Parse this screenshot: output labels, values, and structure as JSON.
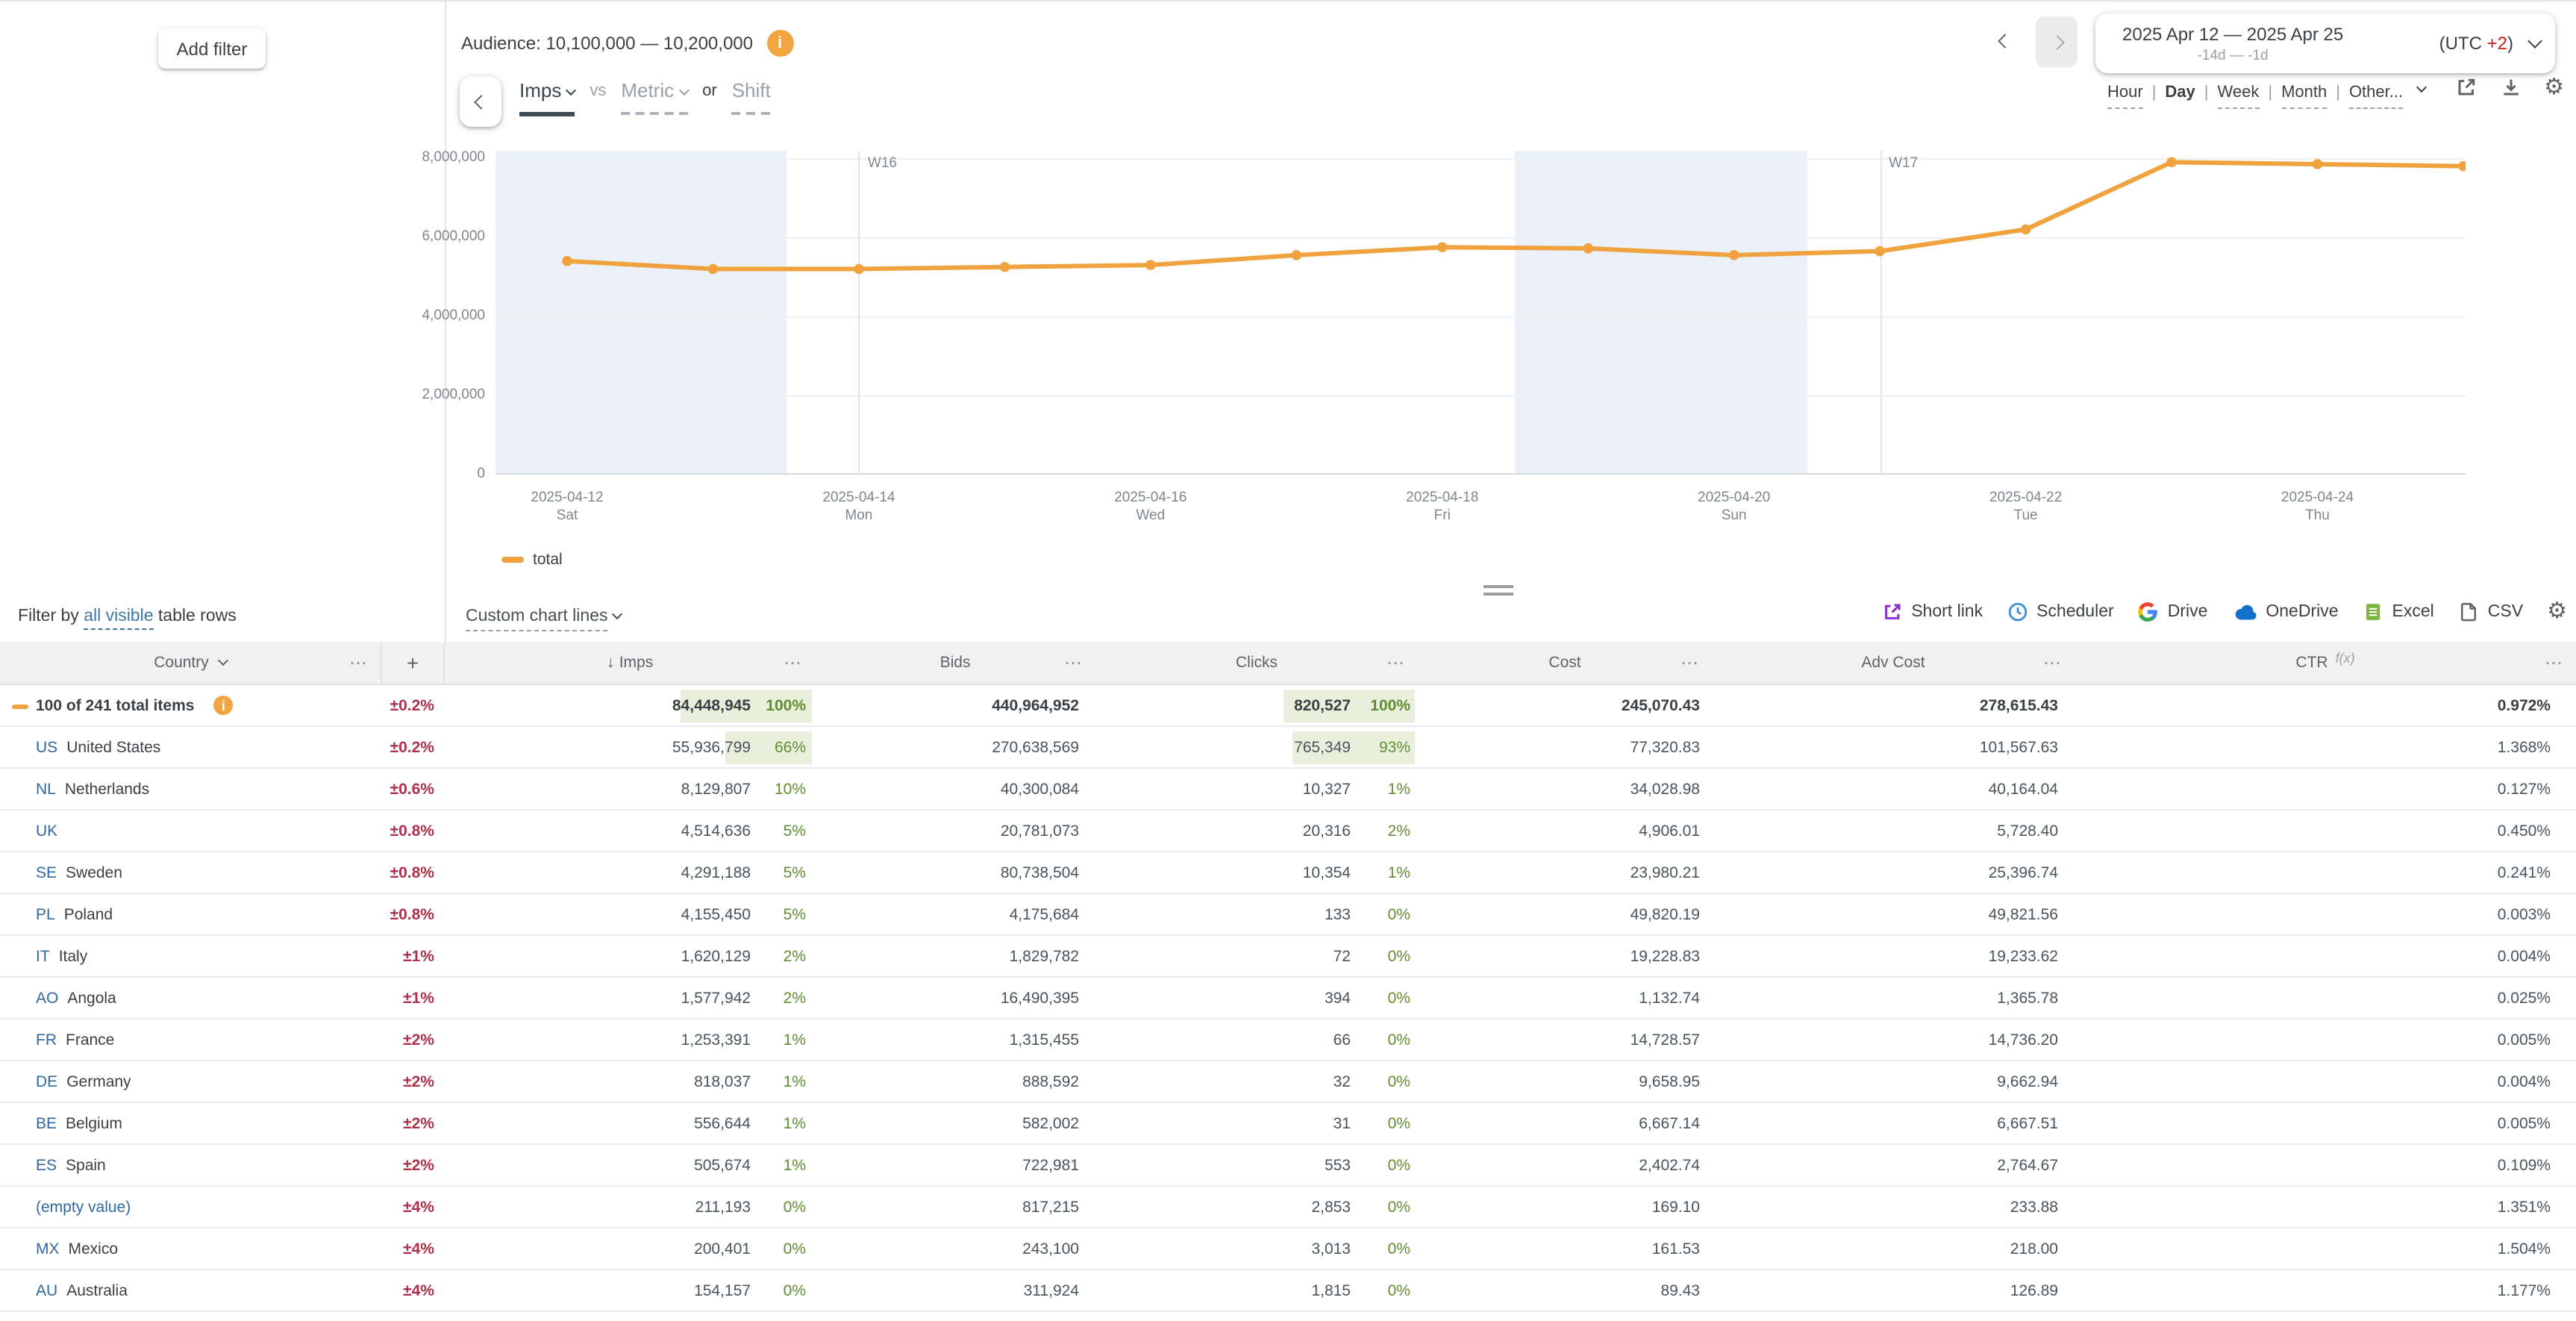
{
  "colors": {
    "accent_orange": "#F0A23E",
    "weekend_band": "#EBF1F8",
    "positive_green": "#5E8E2E",
    "green_bar_bg": "#E9EFDC",
    "uncertainty_red": "#AE3049",
    "country_code_blue": "#33689E",
    "link_blue": "#4176A4",
    "shortlink_purple": "#8630CF",
    "scheduler_blue": "#3E8DDD",
    "excel_green": "#7FB441",
    "utc_red": "#C5221F"
  },
  "icons": {
    "info_glyph": "i",
    "gear_glyph": "⚙",
    "dots_glyph": "⋯",
    "sort_desc_glyph": "↓"
  },
  "topbar": {
    "add_filter_label": "Add filter",
    "audience_label": "Audience: 10,100,000 — 10,200,000",
    "date_range": {
      "title": "2025 Apr 12 — 2025 Apr 25",
      "subtitle": "-14d — -1d",
      "utc_prefix": "(UTC",
      "utc_offset": "+2",
      "utc_suffix": ")"
    }
  },
  "series_picker": {
    "primary": "Imps",
    "vs_label": "vs",
    "metric_label": "Metric",
    "or_label": "or",
    "shift_label": "Shift"
  },
  "granularity": {
    "options": [
      "Hour",
      "Day",
      "Week",
      "Month",
      "Other..."
    ],
    "selected": "Day",
    "separator": "|"
  },
  "chart_data": {
    "type": "line",
    "x": [
      "2025-04-12",
      "2025-04-13",
      "2025-04-14",
      "2025-04-15",
      "2025-04-16",
      "2025-04-17",
      "2025-04-18",
      "2025-04-19",
      "2025-04-20",
      "2025-04-21",
      "2025-04-22",
      "2025-04-23",
      "2025-04-24",
      "2025-04-25"
    ],
    "series": [
      {
        "name": "total",
        "color": "#F0A23E",
        "values": [
          5400000,
          5200000,
          5200000,
          5250000,
          5300000,
          5550000,
          5750000,
          5720000,
          5550000,
          5650000,
          6200000,
          7900000,
          7850000,
          7800000
        ]
      }
    ],
    "ylim": [
      0,
      8190000
    ],
    "grid": true,
    "legend_position": "bottom-left",
    "y_ticks": [
      {
        "value": 0,
        "label": "0"
      },
      {
        "value": 2000000,
        "label": "2,000,000"
      },
      {
        "value": 4000000,
        "label": "4,000,000"
      },
      {
        "value": 6000000,
        "label": "6,000,000"
      },
      {
        "value": 8000000,
        "label": "8,000,000"
      }
    ],
    "x_ticks": [
      {
        "index": 0,
        "date": "2025-04-12",
        "weekday": "Sat"
      },
      {
        "index": 2,
        "date": "2025-04-14",
        "weekday": "Mon"
      },
      {
        "index": 4,
        "date": "2025-04-16",
        "weekday": "Wed"
      },
      {
        "index": 6,
        "date": "2025-04-18",
        "weekday": "Fri"
      },
      {
        "index": 8,
        "date": "2025-04-20",
        "weekday": "Sun"
      },
      {
        "index": 10,
        "date": "2025-04-22",
        "weekday": "Tue"
      },
      {
        "index": 12,
        "date": "2025-04-24",
        "weekday": "Thu"
      }
    ],
    "weekend_bands": [
      {
        "from_index": -0.5,
        "to_index": 1.5
      },
      {
        "from_index": 6.5,
        "to_index": 8.5
      }
    ],
    "week_markers": [
      {
        "index": 2,
        "label": "W16"
      },
      {
        "index": 9,
        "label": "W17"
      }
    ],
    "legend": [
      {
        "label": "total",
        "color": "#F0A23E"
      }
    ]
  },
  "filter_row": {
    "prefix": "Filter by ",
    "link_label": "all visible",
    "suffix": " table rows",
    "custom_chart_lines_label": "Custom chart lines"
  },
  "toolbar": {
    "items": [
      {
        "icon": "short-link-icon",
        "label": "Short link"
      },
      {
        "icon": "scheduler-clock-icon",
        "label": "Scheduler"
      },
      {
        "icon": "google-drive-icon",
        "label": "Drive"
      },
      {
        "icon": "onedrive-cloud-icon",
        "label": "OneDrive"
      },
      {
        "icon": "excel-icon",
        "label": "Excel"
      },
      {
        "icon": "csv-file-icon",
        "label": "CSV"
      }
    ]
  },
  "table": {
    "headers": [
      {
        "label": "Country"
      },
      {
        "label": "+"
      },
      {
        "label": "Imps",
        "sort": "desc"
      },
      {
        "label": "Bids"
      },
      {
        "label": "Clicks"
      },
      {
        "label": "Cost"
      },
      {
        "label": "Adv Cost"
      },
      {
        "label": "CTR",
        "fx": "f(x)"
      }
    ],
    "rows": [
      {
        "icon": "total-dash",
        "info": true,
        "bold": true,
        "code": "",
        "name": "100 of 241 total items",
        "name_blue": false,
        "pm": "±0.2%",
        "imps": "84,448,945",
        "imps_pct": "100%",
        "imps_bar": 100,
        "bids": "440,964,952",
        "clicks": "820,527",
        "clicks_pct": "100%",
        "clicks_bar": 100,
        "cost": "245,070.43",
        "adv_cost": "278,615.43",
        "ctr": "0.972%"
      },
      {
        "code": "US",
        "name": "United States",
        "name_blue": false,
        "pm": "±0.2%",
        "imps": "55,936,799",
        "imps_pct": "66%",
        "imps_bar": 66,
        "bids": "270,638,569",
        "clicks": "765,349",
        "clicks_pct": "93%",
        "clicks_bar": 93,
        "cost": "77,320.83",
        "adv_cost": "101,567.63",
        "ctr": "1.368%"
      },
      {
        "code": "NL",
        "name": "Netherlands",
        "name_blue": false,
        "pm": "±0.6%",
        "imps": "8,129,807",
        "imps_pct": "10%",
        "imps_bar": 0,
        "bids": "40,300,084",
        "clicks": "10,327",
        "clicks_pct": "1%",
        "clicks_bar": 0,
        "cost": "34,028.98",
        "adv_cost": "40,164.04",
        "ctr": "0.127%"
      },
      {
        "code": "UK",
        "name": "",
        "name_blue": false,
        "pm": "±0.8%",
        "imps": "4,514,636",
        "imps_pct": "5%",
        "imps_bar": 0,
        "bids": "20,781,073",
        "clicks": "20,316",
        "clicks_pct": "2%",
        "clicks_bar": 0,
        "cost": "4,906.01",
        "adv_cost": "5,728.40",
        "ctr": "0.450%"
      },
      {
        "code": "SE",
        "name": "Sweden",
        "name_blue": false,
        "pm": "±0.8%",
        "imps": "4,291,188",
        "imps_pct": "5%",
        "imps_bar": 0,
        "bids": "80,738,504",
        "clicks": "10,354",
        "clicks_pct": "1%",
        "clicks_bar": 0,
        "cost": "23,980.21",
        "adv_cost": "25,396.74",
        "ctr": "0.241%"
      },
      {
        "code": "PL",
        "name": "Poland",
        "name_blue": false,
        "pm": "±0.8%",
        "imps": "4,155,450",
        "imps_pct": "5%",
        "imps_bar": 0,
        "bids": "4,175,684",
        "clicks": "133",
        "clicks_pct": "0%",
        "clicks_bar": 0,
        "cost": "49,820.19",
        "adv_cost": "49,821.56",
        "ctr": "0.003%"
      },
      {
        "code": "IT",
        "name": "Italy",
        "name_blue": false,
        "pm": "±1%",
        "imps": "1,620,129",
        "imps_pct": "2%",
        "imps_bar": 0,
        "bids": "1,829,782",
        "clicks": "72",
        "clicks_pct": "0%",
        "clicks_bar": 0,
        "cost": "19,228.83",
        "adv_cost": "19,233.62",
        "ctr": "0.004%"
      },
      {
        "code": "AO",
        "name": "Angola",
        "name_blue": false,
        "pm": "±1%",
        "imps": "1,577,942",
        "imps_pct": "2%",
        "imps_bar": 0,
        "bids": "16,490,395",
        "clicks": "394",
        "clicks_pct": "0%",
        "clicks_bar": 0,
        "cost": "1,132.74",
        "adv_cost": "1,365.78",
        "ctr": "0.025%"
      },
      {
        "code": "FR",
        "name": "France",
        "name_blue": false,
        "pm": "±2%",
        "imps": "1,253,391",
        "imps_pct": "1%",
        "imps_bar": 0,
        "bids": "1,315,455",
        "clicks": "66",
        "clicks_pct": "0%",
        "clicks_bar": 0,
        "cost": "14,728.57",
        "adv_cost": "14,736.20",
        "ctr": "0.005%"
      },
      {
        "code": "DE",
        "name": "Germany",
        "name_blue": false,
        "pm": "±2%",
        "imps": "818,037",
        "imps_pct": "1%",
        "imps_bar": 0,
        "bids": "888,592",
        "clicks": "32",
        "clicks_pct": "0%",
        "clicks_bar": 0,
        "cost": "9,658.95",
        "adv_cost": "9,662.94",
        "ctr": "0.004%"
      },
      {
        "code": "BE",
        "name": "Belgium",
        "name_blue": false,
        "pm": "±2%",
        "imps": "556,644",
        "imps_pct": "1%",
        "imps_bar": 0,
        "bids": "582,002",
        "clicks": "31",
        "clicks_pct": "0%",
        "clicks_bar": 0,
        "cost": "6,667.14",
        "adv_cost": "6,667.51",
        "ctr": "0.005%"
      },
      {
        "code": "ES",
        "name": "Spain",
        "name_blue": false,
        "pm": "±2%",
        "imps": "505,674",
        "imps_pct": "1%",
        "imps_bar": 0,
        "bids": "722,981",
        "clicks": "553",
        "clicks_pct": "0%",
        "clicks_bar": 0,
        "cost": "2,402.74",
        "adv_cost": "2,764.67",
        "ctr": "0.109%"
      },
      {
        "code": "",
        "name": "(empty value)",
        "name_blue": true,
        "pm": "±4%",
        "imps": "211,193",
        "imps_pct": "0%",
        "imps_bar": 0,
        "bids": "817,215",
        "clicks": "2,853",
        "clicks_pct": "0%",
        "clicks_bar": 0,
        "cost": "169.10",
        "adv_cost": "233.88",
        "ctr": "1.351%"
      },
      {
        "code": "MX",
        "name": "Mexico",
        "name_blue": false,
        "pm": "±4%",
        "imps": "200,401",
        "imps_pct": "0%",
        "imps_bar": 0,
        "bids": "243,100",
        "clicks": "3,013",
        "clicks_pct": "0%",
        "clicks_bar": 0,
        "cost": "161.53",
        "adv_cost": "218.00",
        "ctr": "1.504%"
      },
      {
        "code": "AU",
        "name": "Australia",
        "name_blue": false,
        "pm": "±4%",
        "imps": "154,157",
        "imps_pct": "0%",
        "imps_bar": 0,
        "bids": "311,924",
        "clicks": "1,815",
        "clicks_pct": "0%",
        "clicks_bar": 0,
        "cost": "89.43",
        "adv_cost": "126.89",
        "ctr": "1.177%"
      }
    ]
  }
}
